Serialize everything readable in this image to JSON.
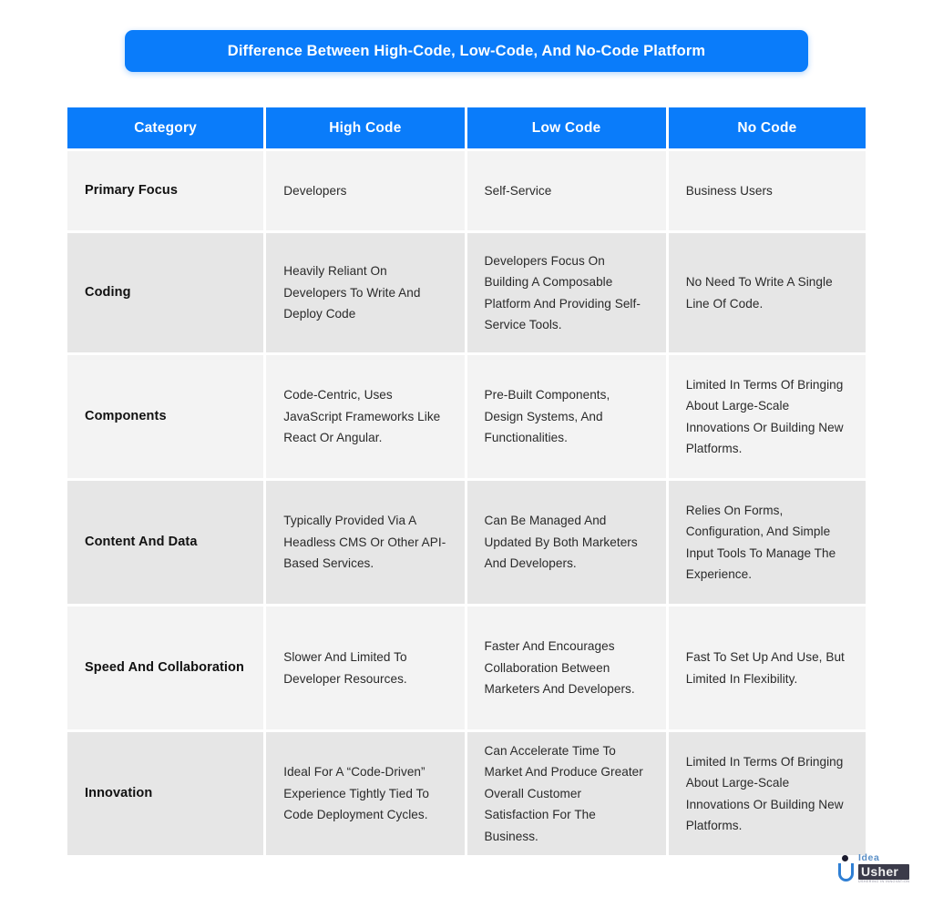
{
  "title": {
    "text": "Difference Between High-Code, Low-Code, And No-Code Platform"
  },
  "colors": {
    "accent": "#0a7cfa",
    "header_text": "#ffffff",
    "row_light": "#f3f3f3",
    "row_dark": "#e6e6e6",
    "body_text": "#2a2a2a",
    "category_text": "#111111",
    "page_background": "#ffffff"
  },
  "table": {
    "columns": [
      "Category",
      "High Code",
      "Low Code",
      "No Code"
    ],
    "rows": [
      {
        "category": "Primary Focus",
        "high_code": "Developers",
        "low_code": "Self-Service",
        "no_code": "Business Users"
      },
      {
        "category": "Coding",
        "high_code": "Heavily Reliant On Developers To Write And Deploy Code",
        "low_code": "Developers Focus On Building A Composable Platform And Providing Self-Service Tools.",
        "no_code": "No Need To Write A Single Line Of Code."
      },
      {
        "category": "Components",
        "high_code": "Code-Centric, Uses JavaScript Frameworks Like React Or Angular.",
        "low_code": "Pre-Built Components, Design Systems, And Functionalities.",
        "no_code": "Limited In Terms Of Bringing About Large-Scale Innovations Or Building New Platforms."
      },
      {
        "category": "Content And Data",
        "high_code": "Typically Provided Via A Headless CMS Or Other API-Based Services.",
        "low_code": "Can Be Managed And Updated By Both Marketers And Developers.",
        "no_code": "Relies On Forms, Configuration, And Simple Input Tools To Manage The Experience."
      },
      {
        "category": "Speed And Collaboration",
        "high_code": "Slower And Limited To Developer Resources.",
        "low_code": "Faster And Encourages Collaboration Between Marketers And Developers.",
        "no_code": "Fast To Set Up And Use, But Limited In Flexibility."
      },
      {
        "category": "Innovation",
        "high_code": "Ideal For A “Code-Driven” Experience Tightly Tied To Code Deployment Cycles.",
        "low_code": "Can Accelerate Time To Market And Produce Greater Overall Customer Satisfaction For The Business.",
        "no_code": "Limited In Terms Of Bringing About Large-Scale Innovations Or Building New Platforms."
      }
    ]
  },
  "logo": {
    "word_top": "Idea",
    "word_bottom": "Usher",
    "tagline": "USHERING IN INNOVATION"
  }
}
